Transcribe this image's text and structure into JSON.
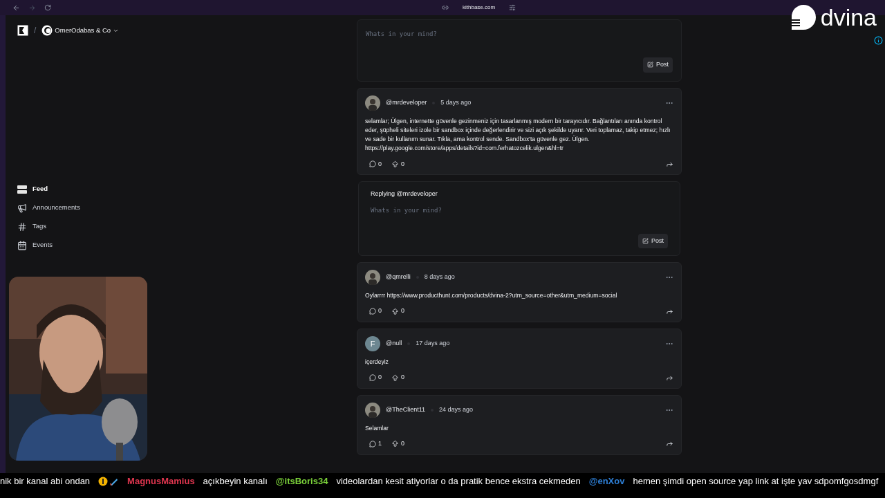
{
  "browser": {
    "url": "kithbase.com"
  },
  "workspace": {
    "separator": "/",
    "name": "OmerOdabas & Co"
  },
  "nav": [
    {
      "kind": "feed",
      "label": "Feed",
      "selected": true
    },
    {
      "kind": "announcements",
      "label": "Announcements",
      "selected": false
    },
    {
      "kind": "tags",
      "label": "Tags",
      "selected": false
    },
    {
      "kind": "events",
      "label": "Events",
      "selected": false
    }
  ],
  "composer": {
    "placeholder": "Whats in your mind?",
    "button": "Post"
  },
  "posts": [
    {
      "author": "@mrdeveloper",
      "time": "5 days ago",
      "text": "selamlar; Ülgen, internette güvenle gezinmeniz için tasarlanmış modern bir tarayıcıdır. Bağlantıları anında kontrol eder, şüpheli siteleri izole bir sandbox içinde değerlendirir ve sizi açık şekilde uyarır. Veri toplamaz, takip etmez; hızlı ve sade bir kullanım sunar. Tıkla, ama kontrol sende. Sandbox'ta güvenle gez. Ülgen. https://play.google.com/store/apps/details?id=com.ferhatozcelik.ulgen&hl=tr",
      "comments": "0",
      "upvotes": "0",
      "reply": {
        "title": "Replying @mrdeveloper",
        "placeholder": "Whats in your mind?",
        "button": "Post"
      }
    },
    {
      "author": "@qmrelli",
      "time": "8 days ago",
      "text": "Oylarrrr https://www.producthunt.com/products/dvina-2?utm_source=other&utm_medium=social",
      "comments": "0",
      "upvotes": "0"
    },
    {
      "author": "@null",
      "time": "17 days ago",
      "avatar": {
        "kind": "letter",
        "letter": "F",
        "color": "#6d8791"
      },
      "text": "içerdeyiz",
      "comments": "0",
      "upvotes": "0"
    },
    {
      "author": "@TheClient11",
      "time": "24 days ago",
      "text": "Selamlar",
      "comments": "1",
      "upvotes": "0"
    }
  ],
  "overlay": {
    "logo": "dvina"
  },
  "ticker": [
    {
      "kind": "text",
      "text": "nik bir kanal abi ondan"
    },
    {
      "kind": "badges"
    },
    {
      "kind": "user",
      "text": "MagnusMamius",
      "color": "#e0364f"
    },
    {
      "kind": "text",
      "text": "açıkbeyin kanalı"
    },
    {
      "kind": "user",
      "text": "@itsBoris34",
      "color": "#7bd23a"
    },
    {
      "kind": "text",
      "text": "videolardan kesit atiyorlar o da pratik bence ekstra cekmeden"
    },
    {
      "kind": "user",
      "text": "@enXov",
      "color": "#2e7fd6"
    },
    {
      "kind": "text",
      "text": "hemen şimdi open source yap link at işte yav sdpomfgosdmgf"
    }
  ]
}
